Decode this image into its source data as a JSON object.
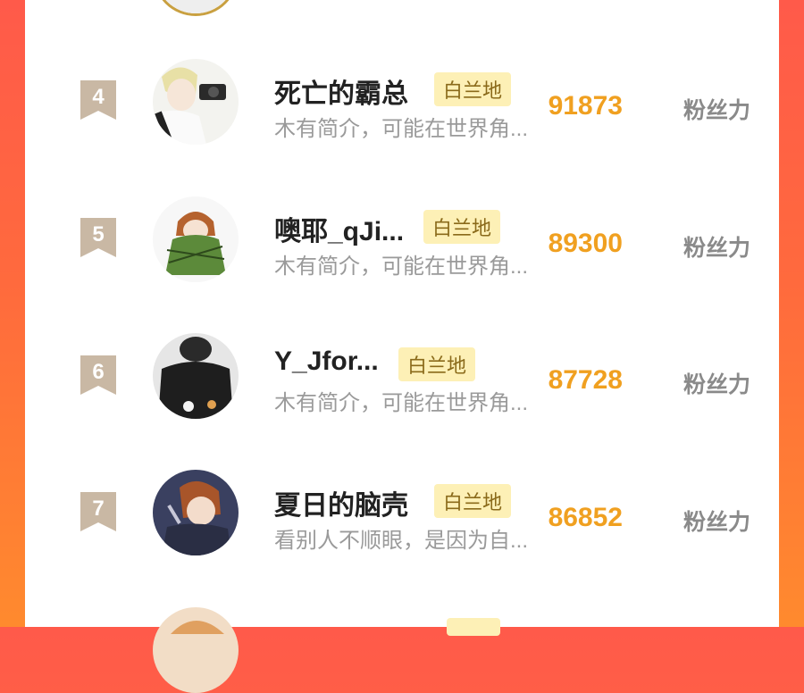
{
  "list": {
    "items": [
      {
        "rank": "4",
        "name": "死亡的霸总",
        "badge": "白兰地",
        "intro": "木有简介，可能在世界角...",
        "score": "91873",
        "unit": "粉丝力"
      },
      {
        "rank": "5",
        "name": "噢耶_qJi...",
        "badge": "白兰地",
        "intro": "木有简介，可能在世界角...",
        "score": "89300",
        "unit": "粉丝力"
      },
      {
        "rank": "6",
        "name": "Y_Jfor...",
        "badge": "白兰地",
        "intro": "木有简介，可能在世界角...",
        "score": "87728",
        "unit": "粉丝力"
      },
      {
        "rank": "7",
        "name": "夏日的脑壳",
        "badge": "白兰地",
        "intro": "看别人不顺眼，是因为自...",
        "score": "86852",
        "unit": "粉丝力"
      }
    ]
  },
  "colors": {
    "accent": "#f0a020",
    "badge_bg": "#fdf0b6",
    "rank_ribbon": "#c9b8a4"
  }
}
